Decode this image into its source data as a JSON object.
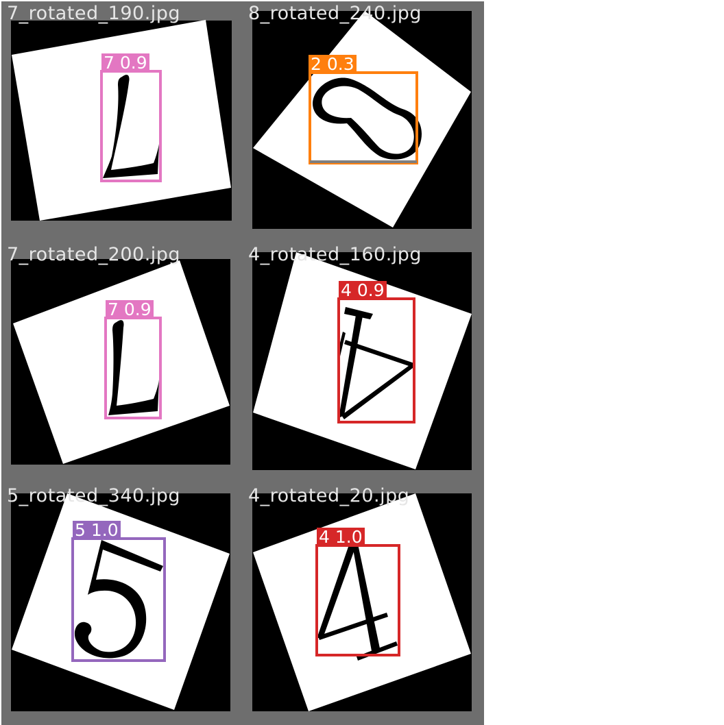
{
  "tiles": [
    {
      "filename": "7_rotated_190.jpg",
      "detections": [
        {
          "class": "7",
          "confidence": "0.9",
          "color": "#e377c2"
        }
      ]
    },
    {
      "filename": "8_rotated_240.jpg",
      "detections": [
        {
          "class": "2",
          "confidence": "0.3",
          "color": "#ff7f0e"
        },
        {
          "class": "",
          "confidence": "",
          "color": "#7f7f7f"
        }
      ]
    },
    {
      "filename": "7_rotated_200.jpg",
      "detections": [
        {
          "class": "7",
          "confidence": "0.9",
          "color": "#e377c2"
        }
      ]
    },
    {
      "filename": "4_rotated_160.jpg",
      "detections": [
        {
          "class": "4",
          "confidence": "0.9",
          "color": "#d62728"
        }
      ]
    },
    {
      "filename": "5_rotated_340.jpg",
      "detections": [
        {
          "class": "5",
          "confidence": "1.0",
          "color": "#9467bd"
        }
      ]
    },
    {
      "filename": "4_rotated_20.jpg",
      "detections": [
        {
          "class": "4",
          "confidence": "1.0",
          "color": "#d62728"
        }
      ]
    }
  ],
  "colors": {
    "tile_border": "#6e6e6e",
    "background": "#000000",
    "card": "#ffffff",
    "glyph": "#000000",
    "filename_text": "#e6e6e6"
  }
}
